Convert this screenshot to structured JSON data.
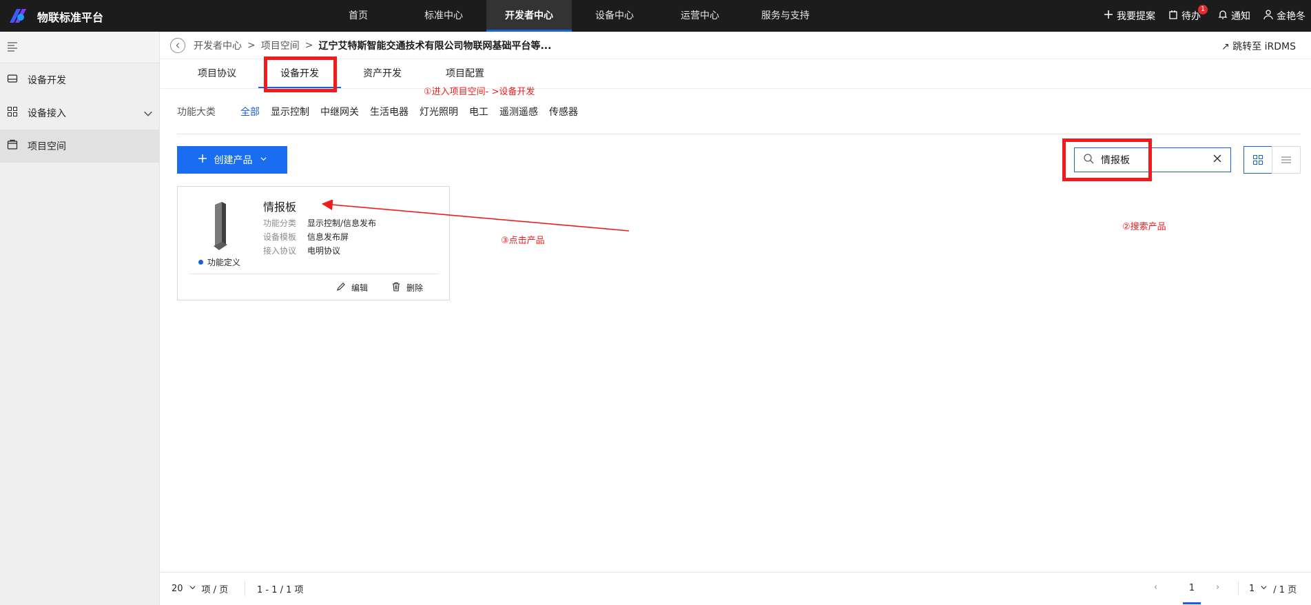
{
  "topbar": {
    "brand": "物联标准平台",
    "nav": [
      "首页",
      "标准中心",
      "开发者中心",
      "设备中心",
      "运营中心",
      "服务与支持"
    ],
    "active_nav": "开发者中心",
    "propose": "我要提案",
    "todo": "待办",
    "todo_count": "1",
    "notify": "通知",
    "user": "金艳冬"
  },
  "sidebar": {
    "items": [
      {
        "label": "设备开发",
        "icon": "device-icon"
      },
      {
        "label": "设备接入",
        "icon": "grid-icon"
      },
      {
        "label": "项目空间",
        "icon": "folder-icon"
      }
    ]
  },
  "breadcrumb": {
    "items": [
      "开发者中心",
      "项目空间"
    ],
    "current": "辽宁艾特斯智能交通技术有限公司物联网基础平台等...",
    "jump": "跳转至 iRDMS"
  },
  "tabs": [
    "项目协议",
    "设备开发",
    "资产开发",
    "项目配置"
  ],
  "filters": {
    "label": "功能大类",
    "items": [
      "全部",
      "显示控制",
      "中继网关",
      "生活电器",
      "灯光照明",
      "电工",
      "遥测遥感",
      "传感器"
    ]
  },
  "toolbar": {
    "create": "创建产品",
    "search_value": "情报板"
  },
  "product": {
    "name": "情报板",
    "status": "功能定义",
    "rows": [
      {
        "k": "功能分类",
        "v": "显示控制/信息发布"
      },
      {
        "k": "设备模板",
        "v": "信息发布屏"
      },
      {
        "k": "接入协议",
        "v": "电明协议"
      }
    ],
    "edit": "编辑",
    "delete": "删除"
  },
  "annotations": {
    "step1": "①进入项目空间- >设备开发",
    "step2": "②搜索产品",
    "step3": "③点击产品"
  },
  "pager": {
    "size": "20",
    "size_unit": "项 / 页",
    "range": "1 - 1 / 1 项",
    "current": "1",
    "jump_value": "1",
    "total_pages": "/ 1 页"
  },
  "colors": {
    "accent": "#1a6cf0",
    "annotation": "#f01c1c",
    "topbar": "#1c1c1c"
  }
}
